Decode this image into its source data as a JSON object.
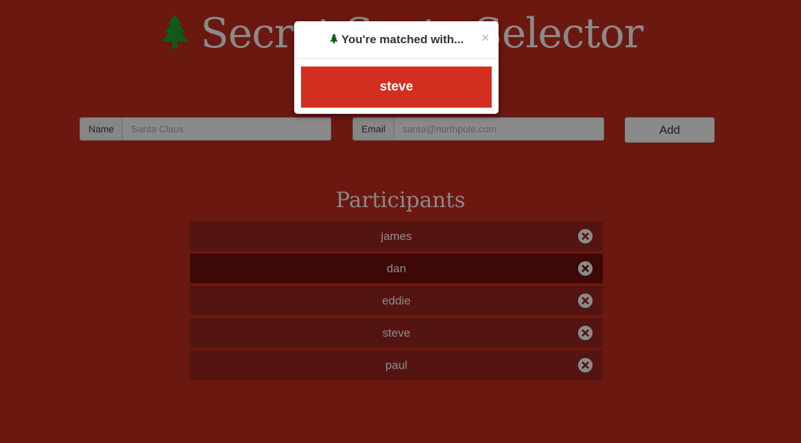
{
  "header": {
    "title": "Secret Santa Selector",
    "icon": "tree-icon",
    "icon_color": "#0d5a1a"
  },
  "form": {
    "name_label": "Name",
    "name_placeholder": "Santa Claus",
    "email_label": "Email",
    "email_placeholder": "santa@northpole.com",
    "add_label": "Add"
  },
  "participants": {
    "heading": "Participants",
    "items": [
      {
        "name": "james",
        "remove_icon": "close-circle-icon"
      },
      {
        "name": "dan",
        "remove_icon": "close-circle-icon"
      },
      {
        "name": "eddie",
        "remove_icon": "close-circle-icon"
      },
      {
        "name": "steve",
        "remove_icon": "close-circle-icon"
      },
      {
        "name": "paul",
        "remove_icon": "close-circle-icon"
      }
    ]
  },
  "modal": {
    "title": "You're matched with...",
    "close_symbol": "×",
    "match_name": "steve"
  },
  "colors": {
    "background": "#6b1811",
    "row_background": "#541411",
    "row_active_background": "#3d0805",
    "match_button": "#d22f21",
    "tree": "#0d5a1a"
  }
}
